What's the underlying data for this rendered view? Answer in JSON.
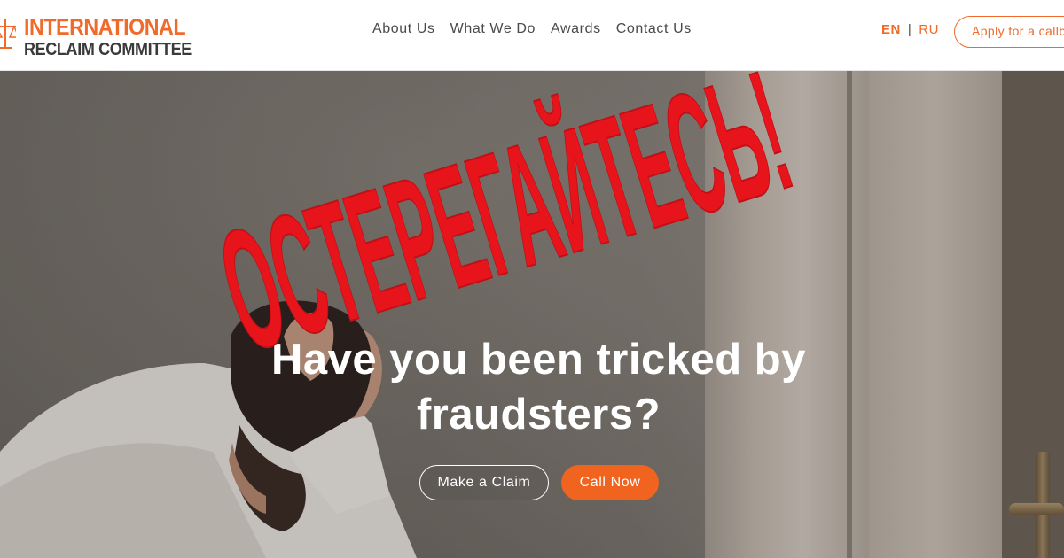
{
  "header": {
    "logo": {
      "line1": "INTERNATIONAL",
      "line2": "RECLAIM COMMITTEE",
      "icon": "scales-of-justice-icon"
    },
    "nav": [
      {
        "label": "About Us"
      },
      {
        "label": "What We Do"
      },
      {
        "label": "Awards"
      },
      {
        "label": "Contact Us"
      }
    ],
    "lang": {
      "en": "EN",
      "separator": "|",
      "ru": "RU"
    },
    "apply_button": "Apply for a callb"
  },
  "hero": {
    "headline_line1": "Have you been tricked by",
    "headline_line2": "fraudsters?",
    "make_claim_button": "Make a Claim",
    "call_now_button": "Call Now"
  },
  "stamp": {
    "text": "ОСТЕРЕГАЙТЕСЬ!",
    "color": "#e8141c"
  },
  "colors": {
    "brand_orange": "#ef6a2b",
    "call_button": "#f0641f",
    "text_dark": "#3a3a3a"
  }
}
